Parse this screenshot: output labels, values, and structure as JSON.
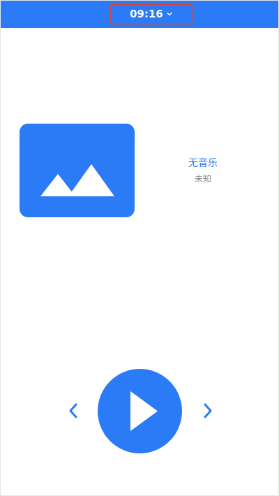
{
  "status_bar": {
    "time": "09:16",
    "dropdown_icon": "chevron-down-icon"
  },
  "player": {
    "album_art_icon": "image-placeholder-icon",
    "title": "无音乐",
    "artist": "未知"
  },
  "controls": {
    "prev_icon": "chevron-left-icon",
    "play_icon": "play-icon",
    "next_icon": "chevron-right-icon"
  },
  "colors": {
    "accent": "#2a7bf5",
    "highlight_border": "#d9453e",
    "secondary_text": "#8a8a8a"
  }
}
